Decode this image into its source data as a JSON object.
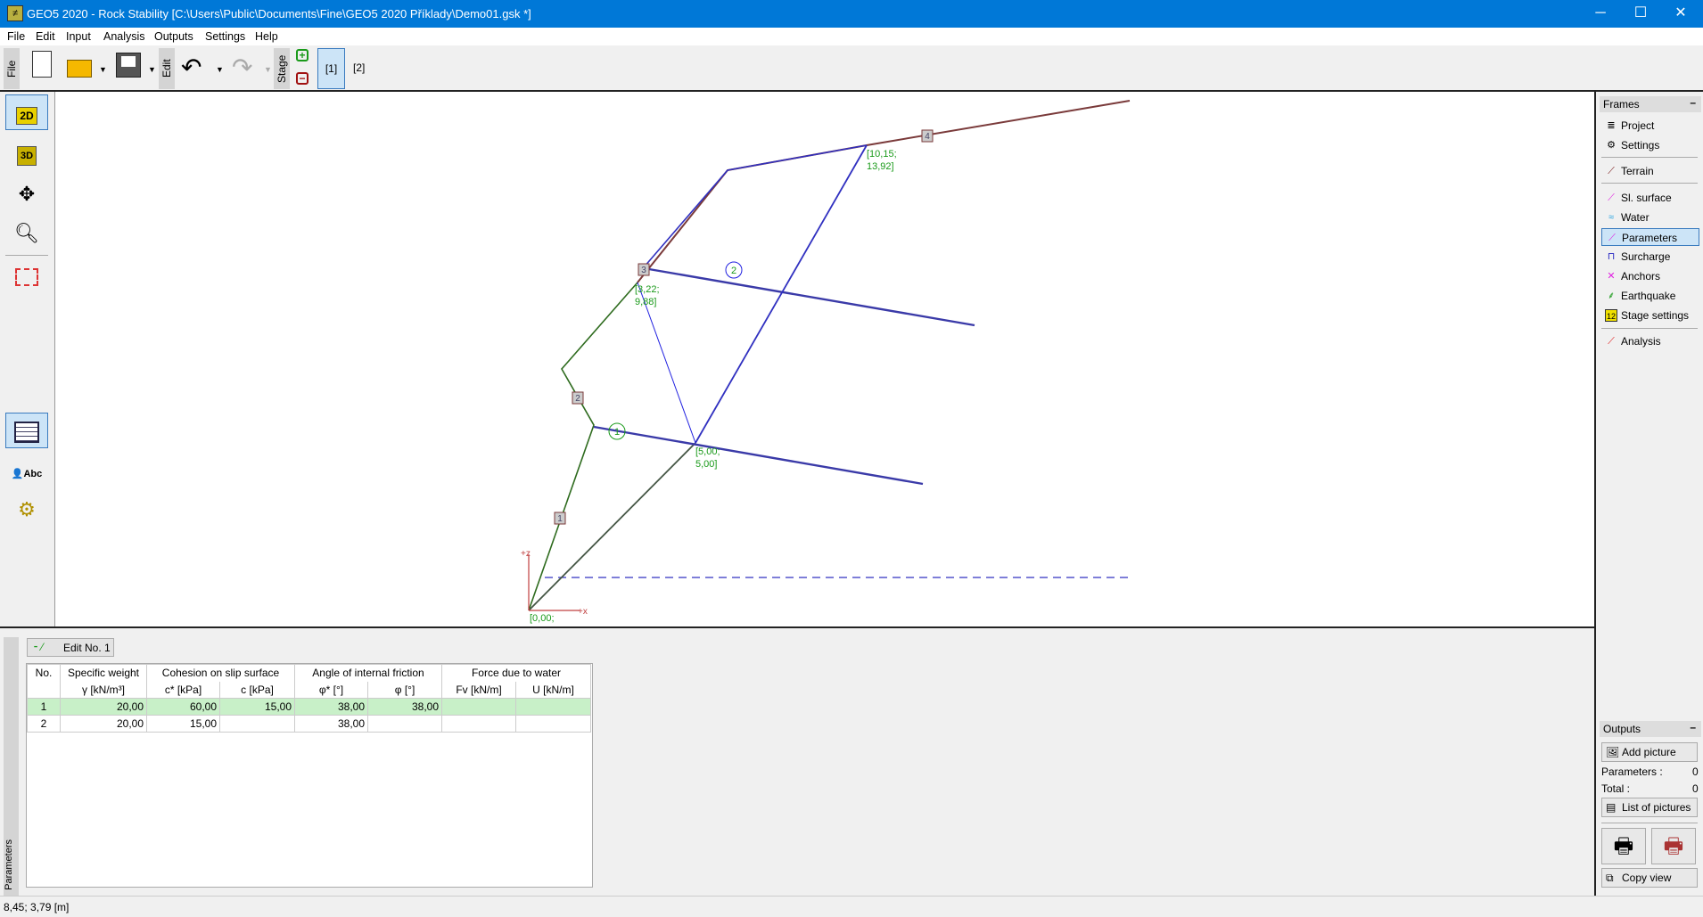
{
  "window": {
    "title": "GEO5 2020 - Rock Stability [C:\\Users\\Public\\Documents\\Fine\\GEO5 2020 Příklady\\Demo01.gsk *]",
    "minimize": "─",
    "maximize": "☐",
    "close": "✕"
  },
  "menu": [
    "File",
    "Edit",
    "Input",
    "Analysis",
    "Outputs",
    "Settings",
    "Help"
  ],
  "toolbar": {
    "file_label": "File",
    "edit_label": "Edit",
    "stage_label": "Stage",
    "stages": [
      "[1]",
      "[2]"
    ],
    "active_stage": "[1]"
  },
  "left_tools": {
    "view_2d": "2D",
    "view_3d": "3D"
  },
  "canvas": {
    "point_labels": [
      "[10,15;",
      "13,92]",
      "[3,22;",
      "9,88]",
      "[5,00;",
      "5,00]",
      "[0,00;"
    ],
    "terrain_points": [
      "1",
      "2",
      "3",
      "4"
    ],
    "joints": [
      "1",
      "2"
    ],
    "axis_z": "+z",
    "axis_x": "+x",
    "colors": {
      "terrain": "#7a3a3a",
      "rock": "#2e6b1e",
      "slip": "#3030c0",
      "label": "#1a9a1a",
      "axis": "#c04040"
    }
  },
  "frames": {
    "header": "Frames",
    "collapse": "–",
    "items": [
      {
        "label": "Project",
        "icon": "document-list-icon"
      },
      {
        "label": "Settings",
        "icon": "gear-icon"
      },
      {
        "label": "Terrain",
        "icon": "terrain-icon"
      },
      {
        "label": "Sl. surface",
        "icon": "slip-surface-icon"
      },
      {
        "label": "Water",
        "icon": "water-icon"
      },
      {
        "label": "Parameters",
        "icon": "parameters-icon",
        "selected": true
      },
      {
        "label": "Surcharge",
        "icon": "surcharge-icon"
      },
      {
        "label": "Anchors",
        "icon": "anchors-icon"
      },
      {
        "label": "Earthquake",
        "icon": "earthquake-icon"
      },
      {
        "label": "Stage settings",
        "icon": "stage-settings-icon"
      },
      {
        "label": "Analysis",
        "icon": "analysis-icon"
      }
    ]
  },
  "outputs": {
    "header": "Outputs",
    "collapse": "–",
    "add_picture": "Add picture",
    "parameters_label": "Parameters :",
    "parameters_value": "0",
    "total_label": "Total :",
    "total_value": "0",
    "list_pictures": "List of pictures",
    "copy_view": "Copy view"
  },
  "bottom": {
    "tab": "Parameters",
    "edit_button": "Edit No. 1",
    "table": {
      "group_headers": [
        "No.",
        "Specific weight",
        "Cohesion on slip surface",
        "Angle of internal friction",
        "Force due to water"
      ],
      "sub_headers": [
        "γ [kN/m³]",
        "c* [kPa]",
        "c [kPa]",
        "φ* [°]",
        "φ [°]",
        "Fv [kN/m]",
        "U [kN/m]"
      ],
      "rows": [
        [
          "1",
          "20,00",
          "60,00",
          "15,00",
          "38,00",
          "38,00",
          "",
          ""
        ],
        [
          "2",
          "20,00",
          "15,00",
          "",
          "38,00",
          "",
          "",
          ""
        ]
      ]
    }
  },
  "status": "8,45; 3,79 [m]"
}
